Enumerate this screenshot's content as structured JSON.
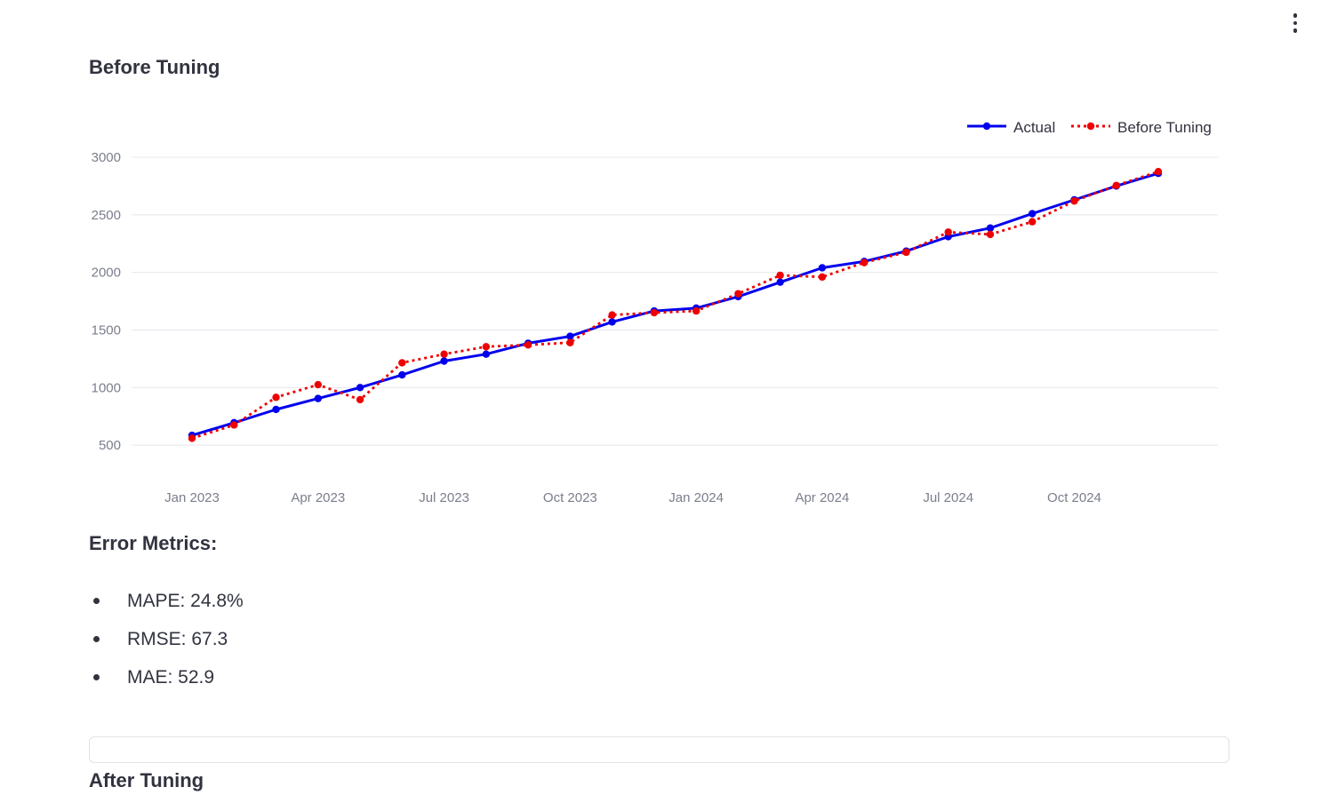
{
  "toolbar": {
    "menu_icon": "kebab-menu-icon"
  },
  "sections": {
    "before_title": "Before Tuning",
    "after_title": "After Tuning"
  },
  "metrics": {
    "heading": "Error Metrics:",
    "items": [
      "MAPE: 24.8%",
      "RMSE: 67.3",
      "MAE: 52.9"
    ]
  },
  "chart_data": {
    "type": "line",
    "title": "",
    "xlabel": "",
    "ylabel": "",
    "x": [
      "2023-01",
      "2023-02",
      "2023-03",
      "2023-04",
      "2023-05",
      "2023-06",
      "2023-07",
      "2023-08",
      "2023-09",
      "2023-10",
      "2023-11",
      "2023-12",
      "2024-01",
      "2024-02",
      "2024-03",
      "2024-04",
      "2024-05",
      "2024-06",
      "2024-07",
      "2024-08",
      "2024-09",
      "2024-10",
      "2024-11",
      "2024-12"
    ],
    "xticks": [
      "Jan 2023",
      "Apr 2023",
      "Jul 2023",
      "Oct 2023",
      "Jan 2024",
      "Apr 2024",
      "Jul 2024",
      "Oct 2024"
    ],
    "yticks": [
      500,
      1000,
      1500,
      2000,
      2500,
      3000
    ],
    "ylim": [
      370,
      3000
    ],
    "grid": true,
    "legend_position": "top-right",
    "series": [
      {
        "name": "Actual",
        "color": "#0000ee",
        "dash": "solid",
        "values": [
          585,
          695,
          810,
          905,
          1000,
          1110,
          1230,
          1290,
          1385,
          1445,
          1570,
          1665,
          1690,
          1790,
          1915,
          2040,
          2095,
          2185,
          2310,
          2385,
          2510,
          2630,
          2750,
          2860
        ]
      },
      {
        "name": "Before Tuning",
        "color": "#ee0000",
        "dash": "dot",
        "values": [
          560,
          675,
          915,
          1025,
          895,
          1215,
          1290,
          1355,
          1370,
          1390,
          1630,
          1650,
          1665,
          1815,
          1975,
          1960,
          2085,
          2175,
          2350,
          2330,
          2440,
          2620,
          2755,
          2875
        ]
      }
    ]
  }
}
